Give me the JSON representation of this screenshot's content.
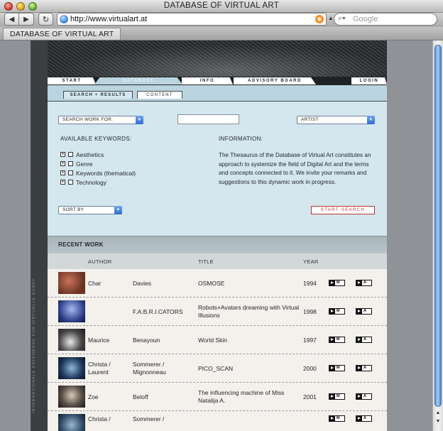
{
  "window": {
    "title": "DATABASE OF VIRTUAL ART"
  },
  "browser": {
    "url": "http://www.virtualart.at",
    "search_placeholder": "Google",
    "tab_title": "DATABASE OF VIRTUAL ART"
  },
  "site": {
    "sidebar_text": "INTERNATIONALE DATENBANK FÜR VIRTUELLE KUNST",
    "nav": [
      {
        "label": "START",
        "active": false
      },
      {
        "label": "DATABASE",
        "active": true
      },
      {
        "label": "INFO",
        "active": false
      },
      {
        "label": "ADVISORY BOARD",
        "active": false
      },
      {
        "label": "LOGIN",
        "active": false
      }
    ],
    "subtabs": [
      "SEARCH + RESULTS",
      "CONTENT"
    ],
    "search": {
      "search_for_label": "SEARCH WORK FOR:",
      "input_value": "",
      "field_select": "ARTIST",
      "keywords_heading": "AVAILABLE KEYWORDS:",
      "keywords": [
        "Aesthetics",
        "Genre",
        "Keywords (thematical)",
        "Technology"
      ],
      "info_heading": "INFORMATION:",
      "info_text": "The Thesaurus of the Database of Virtual Art constitutes an approach to systemize the field of Digital Art and the terms and concepts connected to it. We invite your remarks and suggestions to this dynamic work in progress.",
      "sort_label": "SORT BY",
      "start_button": "START SEARCH"
    },
    "recent": {
      "heading": "RECENT WORK",
      "columns": {
        "author": "AUTHOR",
        "title": "TITLE",
        "year": "YEAR"
      },
      "action_m": "M",
      "action_a": "A",
      "rows": [
        {
          "first": "Char",
          "last": "Davies",
          "title": "OSMOSE",
          "year": "1994",
          "thumb": "#6b3322"
        },
        {
          "first": "",
          "last": "F.A.B.R.I.CATORS",
          "title": "Robots+Avatars dreaming with Virtual Illusions",
          "year": "1998",
          "thumb": "#2d3f8a"
        },
        {
          "first": "Maurice",
          "last": "Benayoun",
          "title": "World Skin",
          "year": "1997",
          "thumb": "#4a4a4a"
        },
        {
          "first": "Christa / Laurent",
          "last": "Sommerer / Mignonneau",
          "title": "PICO_SCAN",
          "year": "2000",
          "thumb": "#1f3a5c"
        },
        {
          "first": "Zoe",
          "last": "Beloff",
          "title": "The influencing machine of Miss Natalija A.",
          "year": "2001",
          "thumb": "#5a5048"
        },
        {
          "first": "Christa /",
          "last": "Sommerer /",
          "title": "",
          "year": "",
          "thumb": "#34506a"
        }
      ]
    }
  }
}
